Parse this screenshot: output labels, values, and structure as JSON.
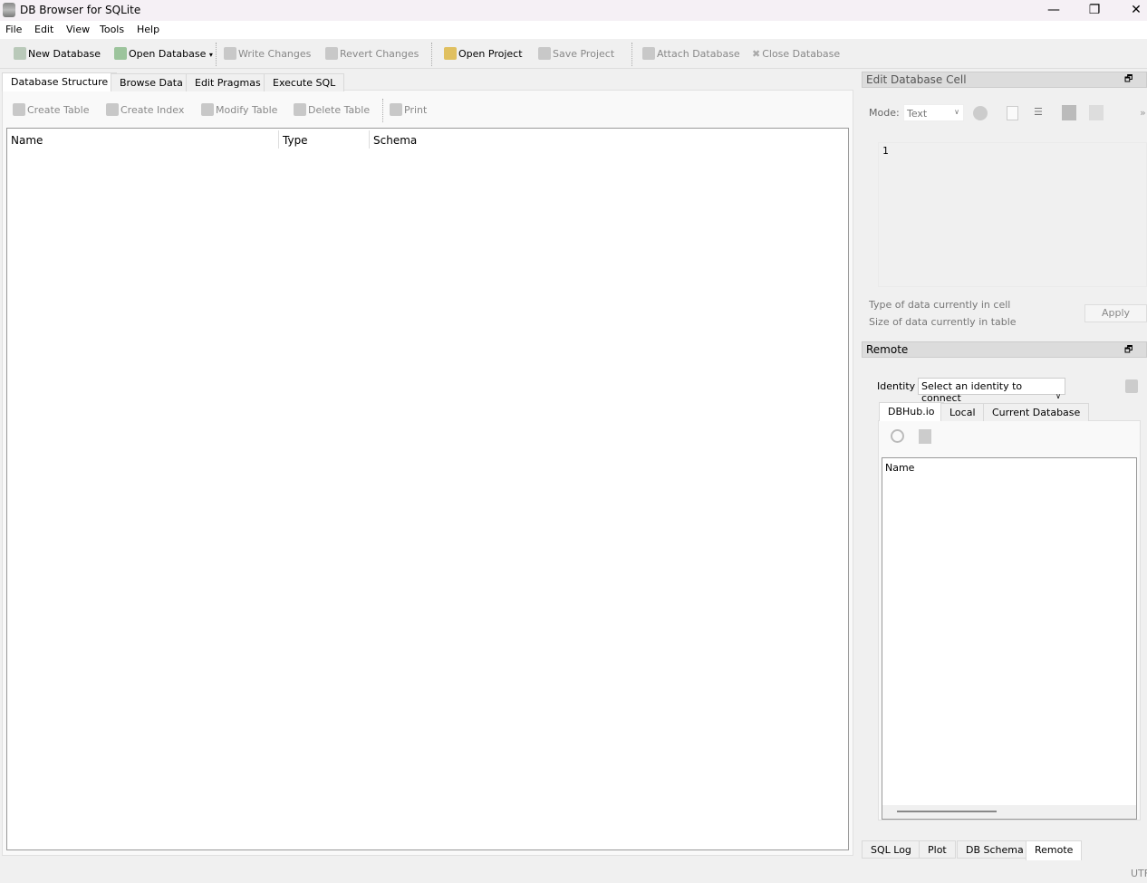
{
  "window": {
    "title": "DB Browser for SQLite",
    "minimize": "—",
    "maximize": "❐",
    "close": "✕"
  },
  "menu": [
    "File",
    "Edit",
    "View",
    "Tools",
    "Help"
  ],
  "toolbar": {
    "new_db": "New Database",
    "open_db": "Open Database",
    "write": "Write Changes",
    "revert": "Revert Changes",
    "open_project": "Open Project",
    "save_project": "Save Project",
    "attach": "Attach Database",
    "close_db": "Close Database"
  },
  "tabs": [
    "Database Structure",
    "Browse Data",
    "Edit Pragmas",
    "Execute SQL"
  ],
  "structure_toolbar": {
    "create_table": "Create Table",
    "create_index": "Create Index",
    "modify_table": "Modify Table",
    "delete_table": "Delete Table",
    "print": "Print"
  },
  "tree_columns": [
    "Name",
    "Type",
    "Schema"
  ],
  "edit_cell": {
    "title": "Edit Database Cell",
    "mode_label": "Mode:",
    "mode_value": "Text",
    "content": "1",
    "type_info": "Type of data currently in cell",
    "size_info": "Size of data currently in table",
    "apply": "Apply",
    "more": "»"
  },
  "remote": {
    "title": "Remote",
    "identity_label": "Identity",
    "identity_value": "Select an identity to connect",
    "tabs": [
      "DBHub.io",
      "Local",
      "Current Database"
    ],
    "column": "Name"
  },
  "bottom_tabs": [
    "SQL Log",
    "Plot",
    "DB Schema",
    "Remote"
  ],
  "status": {
    "encoding": "UTF"
  }
}
